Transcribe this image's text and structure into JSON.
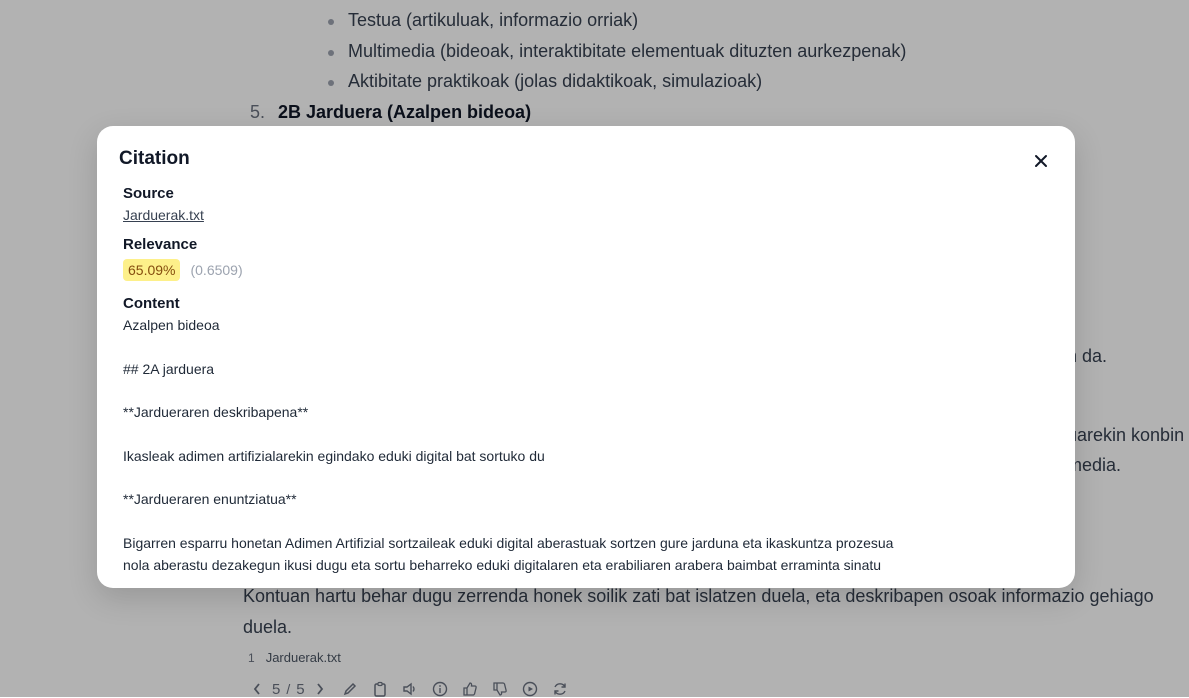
{
  "chat": {
    "bullets": [
      "Testua (artikuluak, informazio orriak)",
      "Multimedia (bideoak, interaktibitate elementuak dituzten aurkezpenak)",
      "Aktibitate praktikoak (jolas didaktikoak, simulazioak)"
    ],
    "list_item": {
      "number": "5.",
      "label": "2B Jarduera (Azalpen bideoa)"
    },
    "partial_lines": [
      "n da.",
      "uarekin konbin",
      "media."
    ],
    "paragraph": [
      "Kontuan hartu behar dugu zerrenda honek soilik zati bat islatzen duela, eta deskribapen osoak informazio gehiago",
      "duela."
    ],
    "source_chip": {
      "index": "1",
      "name": "Jarduerak.txt"
    },
    "pagination": {
      "current": "5",
      "separator": "/",
      "total": "5"
    }
  },
  "citation_modal": {
    "title": "Citation",
    "source_label": "Source",
    "source_name": "Jarduerak.txt",
    "relevance_label": "Relevance",
    "relevance_percent": "65.09%",
    "relevance_score": "(0.6509)",
    "content_label": "Content",
    "content_lines": [
      "Azalpen bideoa",
      "",
      "## 2A jarduera",
      "",
      "**Jardueraren deskribapena**",
      "",
      "Ikasleak adimen artifizialarekin egindako eduki digital bat sortuko du",
      "",
      "**Jardueraren enuntziatua**",
      "",
      "Bigarren esparru honetan Adimen Artifizial sortzaileak eduki digital aberastuak sortzen gure jarduna eta ikaskuntza prozesua",
      "nola aberastu dezakegun ikusi dugu eta sortu beharreko eduki digitalaren eta erabiliaren arabera baimbat erraminta sinatu"
    ]
  },
  "colors": {
    "accent_badge": "#fdf08a",
    "overlay": "rgba(0,0,0,0.30)"
  }
}
